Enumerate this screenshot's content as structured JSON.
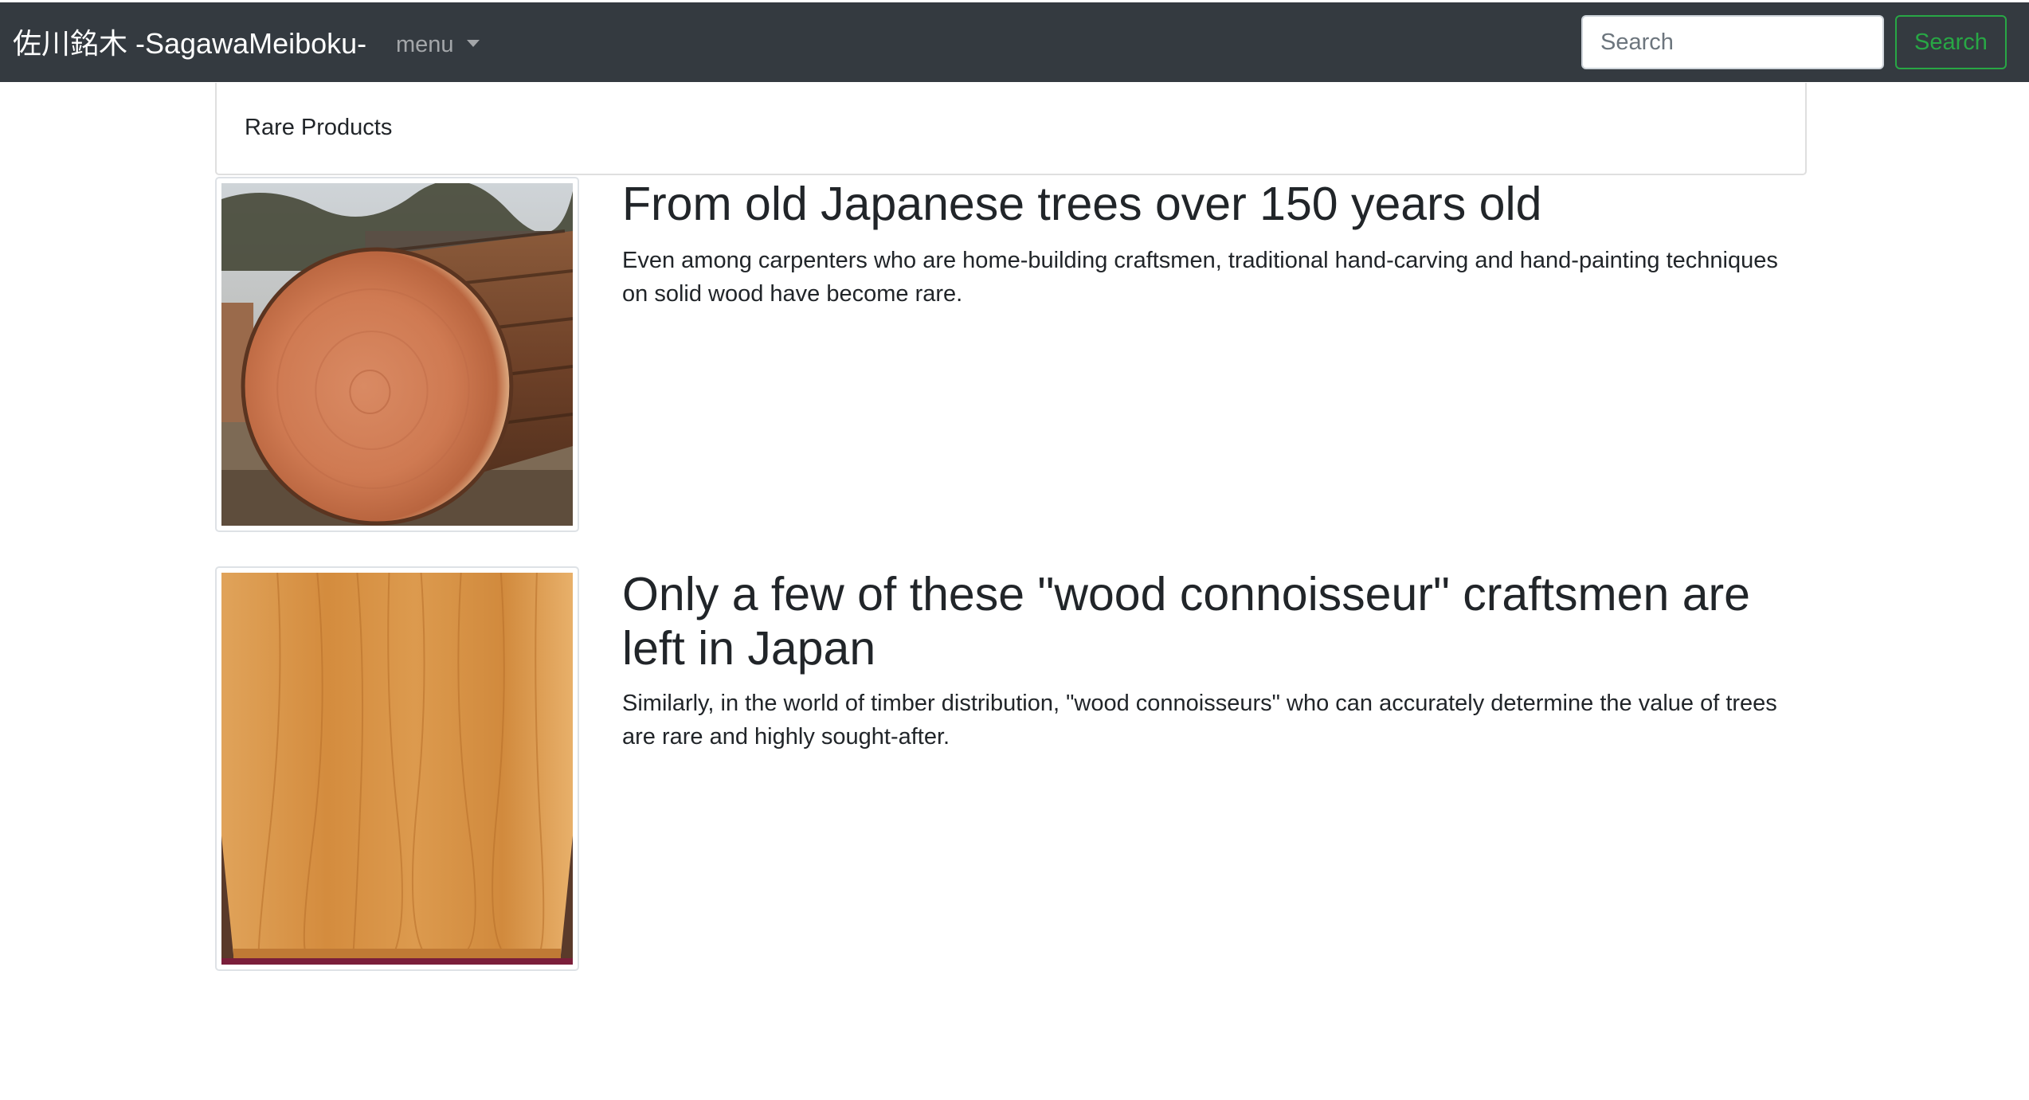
{
  "navbar": {
    "brand": "佐川銘木 -SagawaMeiboku-",
    "menu_label": "menu",
    "search_placeholder": "Search",
    "search_button": "Search"
  },
  "section": {
    "header": "Rare Products"
  },
  "items": [
    {
      "title": "From old Japanese trees over 150 years old",
      "text": "Even among carpenters who are home-building craftsmen, traditional hand-carving and hand-painting techniques on solid wood have become rare."
    },
    {
      "title": "Only a few of these \"wood connoisseur\" craftsmen are left in Japan",
      "text": "Similarly, in the world of timber distribution, \"wood connoisseurs\" who can accurately determine the value of trees are rare and highly sought-after."
    }
  ]
}
